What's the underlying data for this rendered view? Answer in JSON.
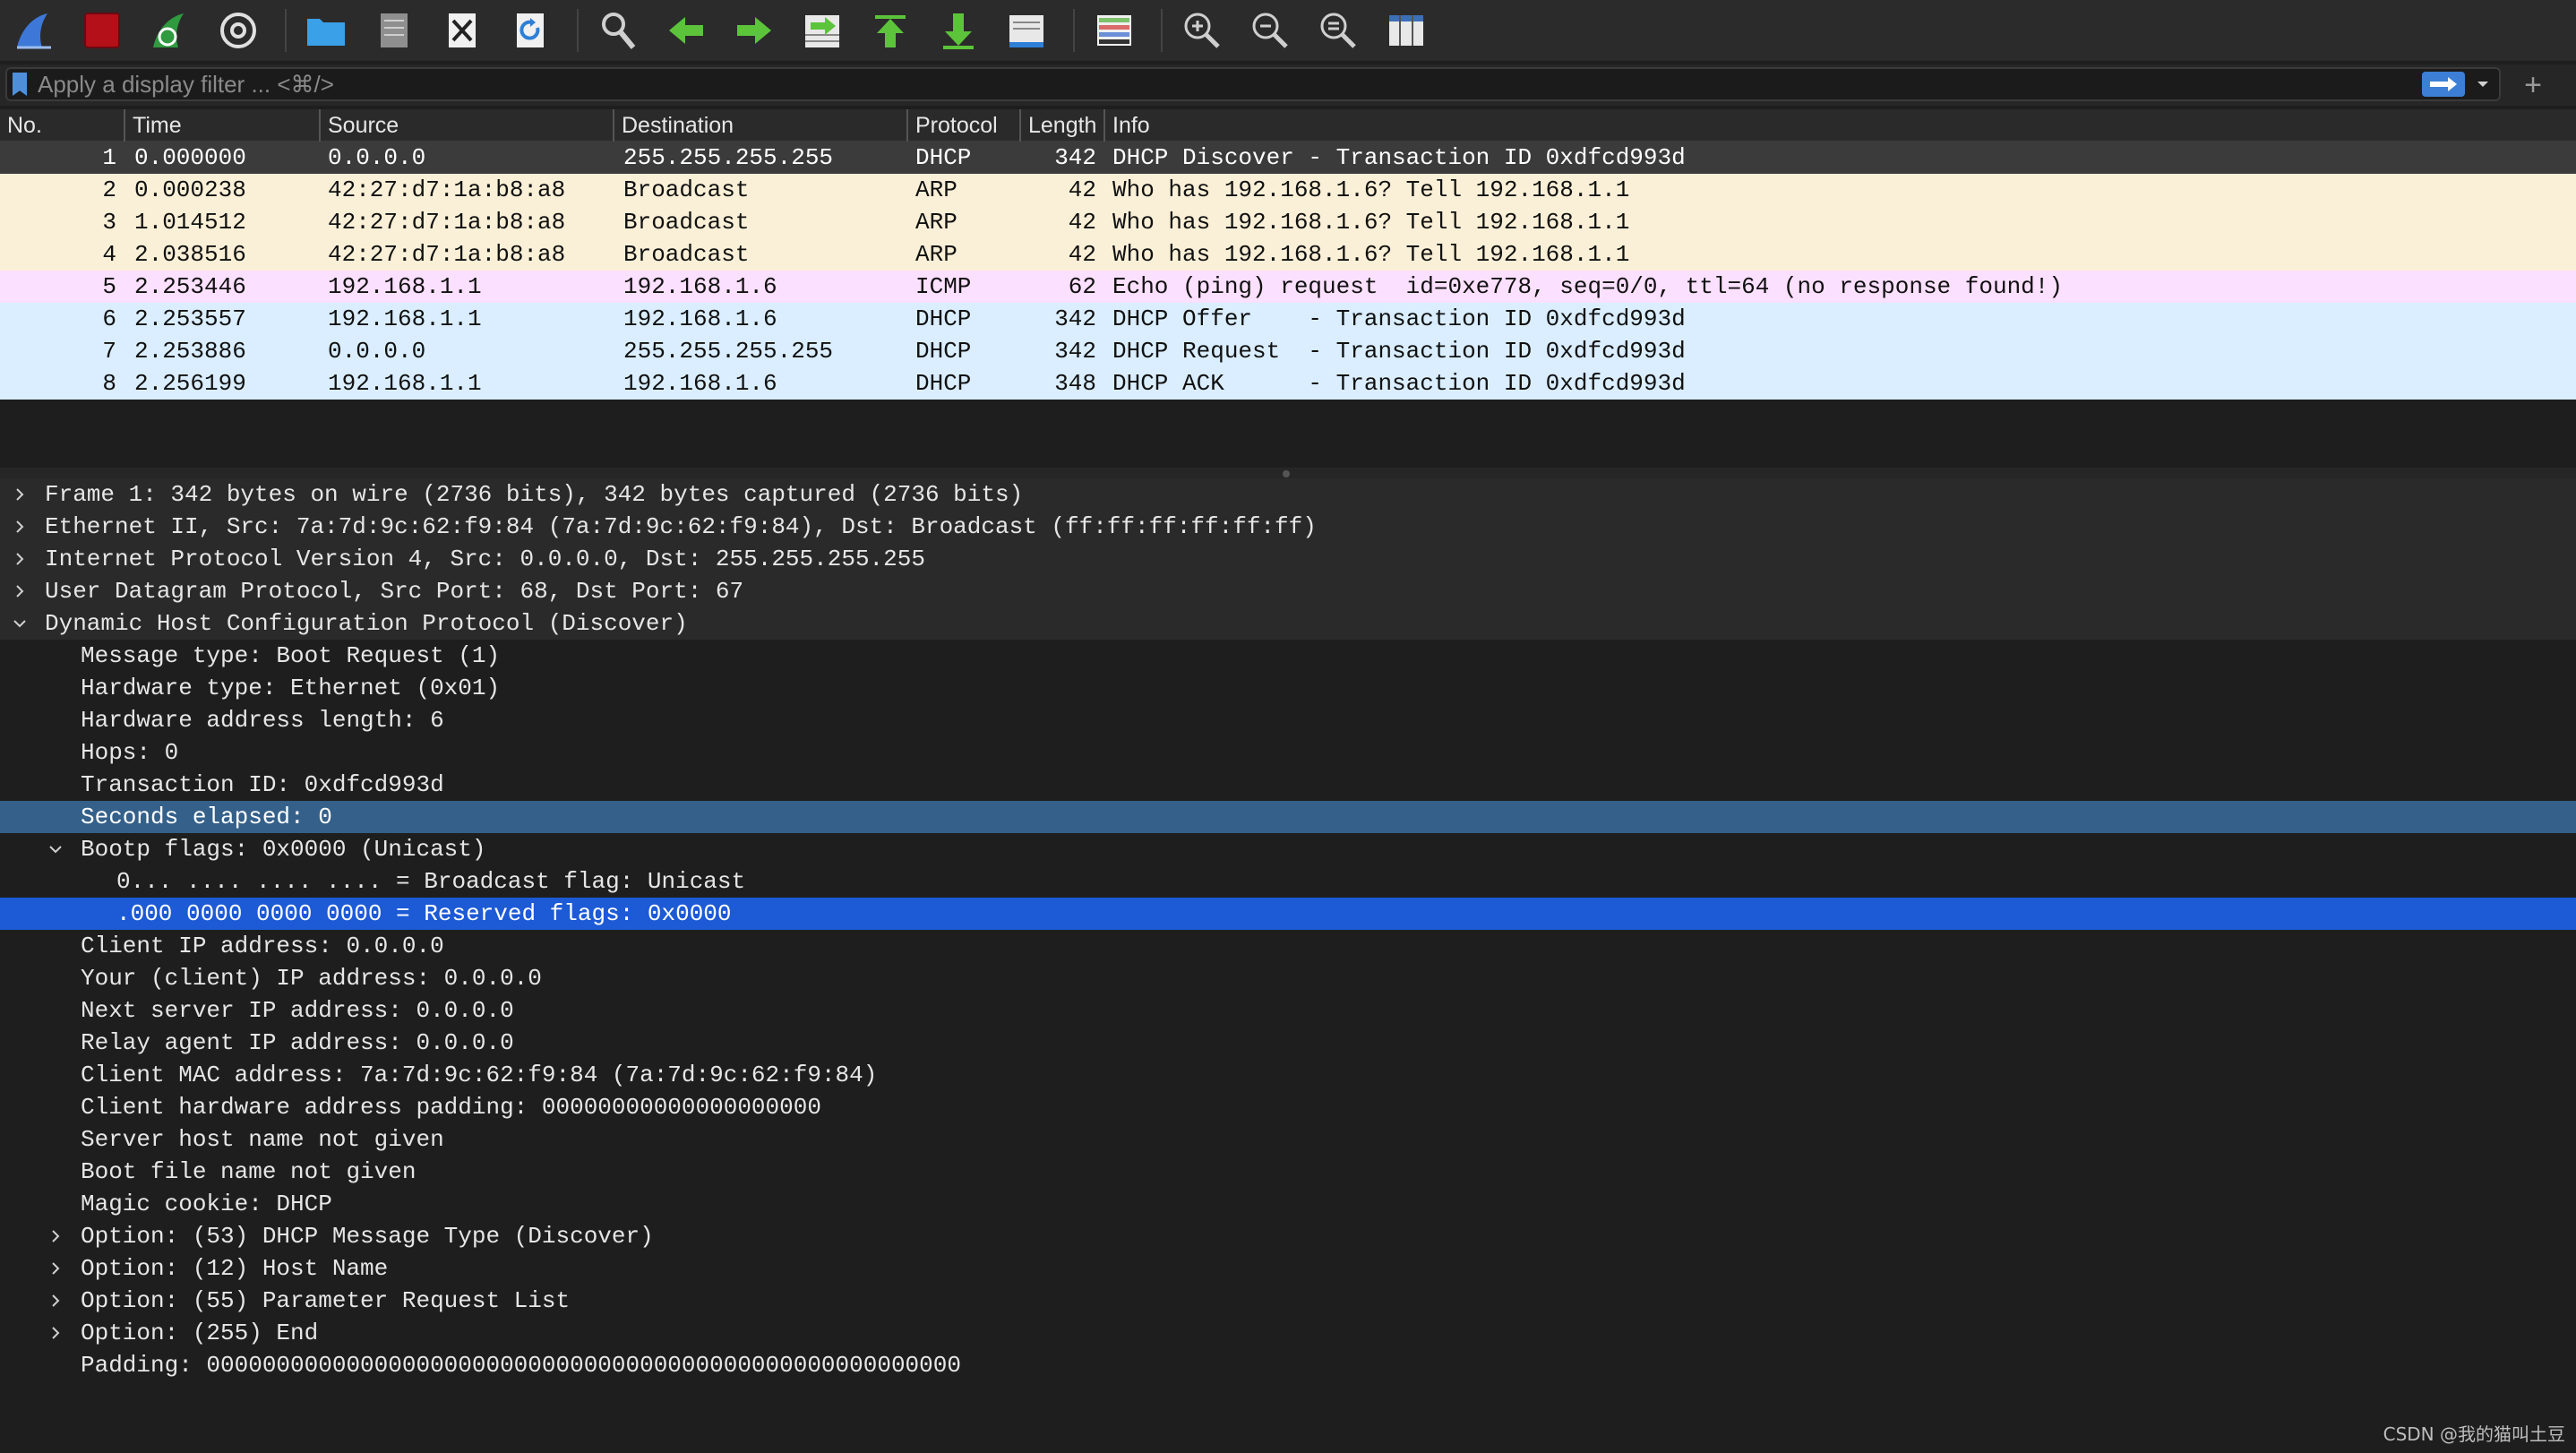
{
  "toolbar": {
    "buttons": [
      {
        "name": "start-capture",
        "icon": "shark-fin-icon"
      },
      {
        "name": "stop-capture",
        "icon": "stop-square-icon"
      },
      {
        "name": "restart-capture",
        "icon": "restart-fin-icon"
      },
      {
        "name": "capture-options",
        "icon": "gear-icon"
      },
      {
        "name": "open-file",
        "icon": "folder-icon"
      },
      {
        "name": "save-file",
        "icon": "file-icon"
      },
      {
        "name": "close-file",
        "icon": "close-file-icon"
      },
      {
        "name": "reload-file",
        "icon": "reload-icon"
      },
      {
        "name": "find-packet",
        "icon": "magnifier-icon"
      },
      {
        "name": "go-back",
        "icon": "arrow-left-icon"
      },
      {
        "name": "go-forward",
        "icon": "arrow-right-icon"
      },
      {
        "name": "go-to-packet",
        "icon": "goto-packet-icon"
      },
      {
        "name": "go-first",
        "icon": "arrow-up-icon"
      },
      {
        "name": "go-last",
        "icon": "arrow-down-icon"
      },
      {
        "name": "auto-scroll",
        "icon": "autoscroll-icon"
      },
      {
        "name": "colorize",
        "icon": "colorize-icon"
      },
      {
        "name": "zoom-in",
        "icon": "zoom-in-icon"
      },
      {
        "name": "zoom-out",
        "icon": "zoom-out-icon"
      },
      {
        "name": "normal-size",
        "icon": "zoom-reset-icon"
      },
      {
        "name": "resize-columns",
        "icon": "resize-columns-icon"
      }
    ]
  },
  "filter": {
    "placeholder": "Apply a display filter ... <⌘/>",
    "value": ""
  },
  "packet_list": {
    "columns": [
      "No.",
      "Time",
      "Source",
      "Destination",
      "Protocol",
      "Length",
      "Info"
    ],
    "colors": {
      "DHCP": "#daeeff",
      "ARP": "#faf0d7",
      "ICMP": "#fce0ff"
    },
    "rows": [
      {
        "no": "1",
        "time": "0.000000",
        "source": "0.0.0.0",
        "destination": "255.255.255.255",
        "protocol": "DHCP",
        "length": "342",
        "info": "DHCP Discover - Transaction ID 0xdfcd993d",
        "selected": true
      },
      {
        "no": "2",
        "time": "0.000238",
        "source": "42:27:d7:1a:b8:a8",
        "destination": "Broadcast",
        "protocol": "ARP",
        "length": "42",
        "info": "Who has 192.168.1.6? Tell 192.168.1.1"
      },
      {
        "no": "3",
        "time": "1.014512",
        "source": "42:27:d7:1a:b8:a8",
        "destination": "Broadcast",
        "protocol": "ARP",
        "length": "42",
        "info": "Who has 192.168.1.6? Tell 192.168.1.1"
      },
      {
        "no": "4",
        "time": "2.038516",
        "source": "42:27:d7:1a:b8:a8",
        "destination": "Broadcast",
        "protocol": "ARP",
        "length": "42",
        "info": "Who has 192.168.1.6? Tell 192.168.1.1"
      },
      {
        "no": "5",
        "time": "2.253446",
        "source": "192.168.1.1",
        "destination": "192.168.1.6",
        "protocol": "ICMP",
        "length": "62",
        "info": "Echo (ping) request  id=0xe778, seq=0/0, ttl=64 (no response found!)"
      },
      {
        "no": "6",
        "time": "2.253557",
        "source": "192.168.1.1",
        "destination": "192.168.1.6",
        "protocol": "DHCP",
        "length": "342",
        "info": "DHCP Offer    - Transaction ID 0xdfcd993d"
      },
      {
        "no": "7",
        "time": "2.253886",
        "source": "0.0.0.0",
        "destination": "255.255.255.255",
        "protocol": "DHCP",
        "length": "342",
        "info": "DHCP Request  - Transaction ID 0xdfcd993d"
      },
      {
        "no": "8",
        "time": "2.256199",
        "source": "192.168.1.1",
        "destination": "192.168.1.6",
        "protocol": "DHCP",
        "length": "348",
        "info": "DHCP ACK      - Transaction ID 0xdfcd993d"
      }
    ]
  },
  "details": {
    "rows": [
      {
        "level": 0,
        "expander": "collapsed",
        "text": "Frame 1: 342 bytes on wire (2736 bits), 342 bytes captured (2736 bits)"
      },
      {
        "level": 0,
        "expander": "collapsed",
        "text": "Ethernet II, Src: 7a:7d:9c:62:f9:84 (7a:7d:9c:62:f9:84), Dst: Broadcast (ff:ff:ff:ff:ff:ff)"
      },
      {
        "level": 0,
        "expander": "collapsed",
        "text": "Internet Protocol Version 4, Src: 0.0.0.0, Dst: 255.255.255.255"
      },
      {
        "level": 0,
        "expander": "collapsed",
        "text": "User Datagram Protocol, Src Port: 68, Dst Port: 67"
      },
      {
        "level": 0,
        "expander": "expanded",
        "text": "Dynamic Host Configuration Protocol (Discover)"
      },
      {
        "level": 1,
        "expander": "none",
        "text": "Message type: Boot Request (1)"
      },
      {
        "level": 1,
        "expander": "none",
        "text": "Hardware type: Ethernet (0x01)"
      },
      {
        "level": 1,
        "expander": "none",
        "text": "Hardware address length: 6"
      },
      {
        "level": 1,
        "expander": "none",
        "text": "Hops: 0"
      },
      {
        "level": 1,
        "expander": "none",
        "text": "Transaction ID: 0xdfcd993d"
      },
      {
        "level": 1,
        "expander": "none",
        "text": "Seconds elapsed: 0",
        "highlight": "dim"
      },
      {
        "level": 1,
        "expander": "expanded",
        "text": "Bootp flags: 0x0000 (Unicast)"
      },
      {
        "level": 2,
        "expander": "none",
        "text": "0... .... .... .... = Broadcast flag: Unicast"
      },
      {
        "level": 2,
        "expander": "none",
        "text": ".000 0000 0000 0000 = Reserved flags: 0x0000",
        "highlight": "bright"
      },
      {
        "level": 1,
        "expander": "none",
        "text": "Client IP address: 0.0.0.0"
      },
      {
        "level": 1,
        "expander": "none",
        "text": "Your (client) IP address: 0.0.0.0"
      },
      {
        "level": 1,
        "expander": "none",
        "text": "Next server IP address: 0.0.0.0"
      },
      {
        "level": 1,
        "expander": "none",
        "text": "Relay agent IP address: 0.0.0.0"
      },
      {
        "level": 1,
        "expander": "none",
        "text": "Client MAC address: 7a:7d:9c:62:f9:84 (7a:7d:9c:62:f9:84)"
      },
      {
        "level": 1,
        "expander": "none",
        "text": "Client hardware address padding: 00000000000000000000"
      },
      {
        "level": 1,
        "expander": "none",
        "text": "Server host name not given"
      },
      {
        "level": 1,
        "expander": "none",
        "text": "Boot file name not given"
      },
      {
        "level": 1,
        "expander": "none",
        "text": "Magic cookie: DHCP"
      },
      {
        "level": 1,
        "expander": "collapsed",
        "text": "Option: (53) DHCP Message Type (Discover)"
      },
      {
        "level": 1,
        "expander": "collapsed",
        "text": "Option: (12) Host Name"
      },
      {
        "level": 1,
        "expander": "collapsed",
        "text": "Option: (55) Parameter Request List"
      },
      {
        "level": 1,
        "expander": "collapsed",
        "text": "Option: (255) End"
      },
      {
        "level": 1,
        "expander": "none",
        "text": "Padding: 000000000000000000000000000000000000000000000000000000"
      }
    ]
  },
  "watermark": "CSDN @我的猫叫土豆"
}
